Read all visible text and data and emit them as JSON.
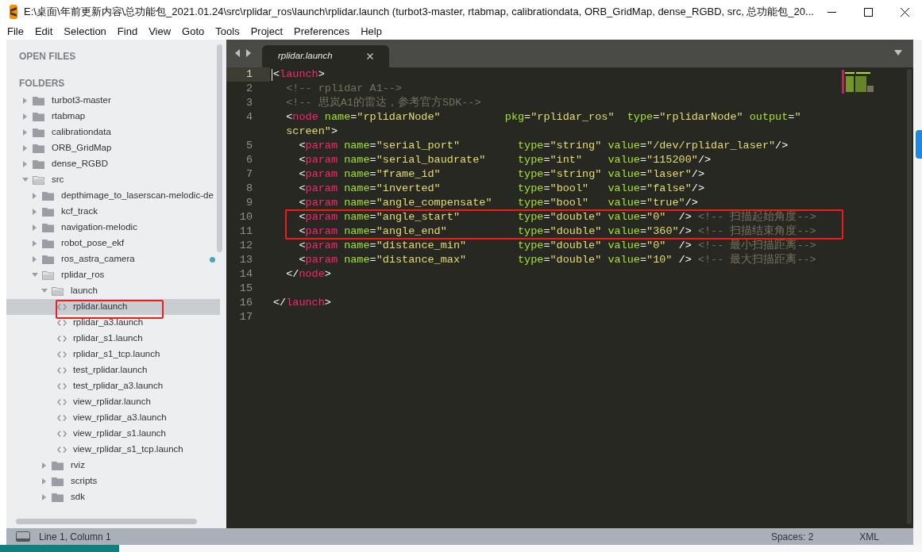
{
  "window": {
    "title": "E:\\桌面\\年前更新内容\\总功能包_2021.01.24\\src\\rplidar_ros\\launch\\rplidar.launch (turbot3-master, rtabmap, calibrationdata, ORB_GridMap, dense_RGBD, src, 总功能包_20..."
  },
  "menu": [
    "File",
    "Edit",
    "Selection",
    "Find",
    "View",
    "Goto",
    "Tools",
    "Project",
    "Preferences",
    "Help"
  ],
  "sidebar": {
    "open_files_heading": "OPEN FILES",
    "folders_heading": "FOLDERS",
    "tree": [
      {
        "kind": "folder",
        "label": "turbot3-master",
        "expanded": false,
        "selected": false
      },
      {
        "kind": "folder",
        "label": "rtabmap",
        "expanded": false,
        "selected": false
      },
      {
        "kind": "folder",
        "label": "calibrationdata",
        "expanded": false,
        "selected": false
      },
      {
        "kind": "folder",
        "label": "ORB_GridMap",
        "expanded": false,
        "selected": false
      },
      {
        "kind": "folder",
        "label": "dense_RGBD",
        "expanded": false,
        "selected": false
      },
      {
        "kind": "folder",
        "label": "src",
        "expanded": true,
        "selected": false,
        "children": [
          {
            "kind": "folder",
            "label": "depthimage_to_laserscan-melodic-de",
            "expanded": false,
            "selected": false
          },
          {
            "kind": "folder",
            "label": "kcf_track",
            "expanded": false,
            "selected": false
          },
          {
            "kind": "folder",
            "label": "navigation-melodic",
            "expanded": false,
            "selected": false
          },
          {
            "kind": "folder",
            "label": "robot_pose_ekf",
            "expanded": false,
            "selected": false
          },
          {
            "kind": "folder",
            "label": "ros_astra_camera",
            "expanded": false,
            "selected": false,
            "modified": true
          },
          {
            "kind": "folder",
            "label": "rplidar_ros",
            "expanded": true,
            "selected": false,
            "children": [
              {
                "kind": "folder",
                "label": "launch",
                "expanded": true,
                "selected": false,
                "children": [
                  {
                    "kind": "file",
                    "label": "rplidar.launch",
                    "selected": true,
                    "annotated": true
                  },
                  {
                    "kind": "file",
                    "label": "rplidar_a3.launch",
                    "selected": false
                  },
                  {
                    "kind": "file",
                    "label": "rplidar_s1.launch",
                    "selected": false
                  },
                  {
                    "kind": "file",
                    "label": "rplidar_s1_tcp.launch",
                    "selected": false
                  },
                  {
                    "kind": "file",
                    "label": "test_rplidar.launch",
                    "selected": false
                  },
                  {
                    "kind": "file",
                    "label": "test_rplidar_a3.launch",
                    "selected": false
                  },
                  {
                    "kind": "file",
                    "label": "view_rplidar.launch",
                    "selected": false
                  },
                  {
                    "kind": "file",
                    "label": "view_rplidar_a3.launch",
                    "selected": false
                  },
                  {
                    "kind": "file",
                    "label": "view_rplidar_s1.launch",
                    "selected": false
                  },
                  {
                    "kind": "file",
                    "label": "view_rplidar_s1_tcp.launch",
                    "selected": false
                  }
                ]
              },
              {
                "kind": "folder",
                "label": "rviz",
                "expanded": false,
                "selected": false
              },
              {
                "kind": "folder",
                "label": "scripts",
                "expanded": false,
                "selected": false
              },
              {
                "kind": "folder",
                "label": "sdk",
                "expanded": false,
                "selected": false
              }
            ]
          }
        ]
      }
    ]
  },
  "tabs": [
    {
      "label": "rplidar.launch",
      "selected": true
    }
  ],
  "editor": {
    "lines": [
      {
        "number": "1",
        "current": true,
        "segments": [
          "<launch>"
        ]
      },
      {
        "number": "2",
        "segments": [
          "  <!-- rplidar A1-->"
        ]
      },
      {
        "number": "3",
        "segments": [
          "  <!-- 思岚A1的雷达，参考官方SDK-->"
        ]
      },
      {
        "number": "4",
        "segments": [
          "  <node name=\"rplidarNode\"          ",
          "pkg=\"rplidar_ros\"  type=\"rplidarNode\" output=\""
        ],
        "wrap_text": "screen\">"
      },
      {
        "number": "5",
        "segments": [
          "    <param name=\"serial_port\"         ",
          "type=\"string\" value=\"/dev/rplidar_laser\"/>"
        ]
      },
      {
        "number": "6",
        "segments": [
          "    <param name=\"serial_baudrate\"     ",
          "type=\"int\"    value=\"115200\"/>"
        ]
      },
      {
        "number": "7",
        "segments": [
          "    <param name=\"frame_id\"            ",
          "type=\"string\" value=\"laser\"/>"
        ]
      },
      {
        "number": "8",
        "segments": [
          "    <param name=\"inverted\"            ",
          "type=\"bool\"   value=\"false\"/>"
        ]
      },
      {
        "number": "9",
        "segments": [
          "    <param name=\"angle_compensate\"    ",
          "type=\"bool\"   value=\"true\"/>"
        ]
      },
      {
        "number": "10",
        "annotated": true,
        "segments": [
          "    <param name=\"angle_start\"         ",
          "type=\"double\" value=\"0\"  /> ",
          "<!-- 扫描起始角度-->"
        ]
      },
      {
        "number": "11",
        "annotated": true,
        "segments": [
          "    <param name=\"angle_end\"           ",
          "type=\"double\" value=\"360\"/> ",
          "<!-- 扫描结束角度-->"
        ]
      },
      {
        "number": "12",
        "segments": [
          "    <param name=\"distance_min\"        ",
          "type=\"double\" value=\"0\"  /> ",
          "<!-- 最小扫描距离-->"
        ]
      },
      {
        "number": "13",
        "segments": [
          "    <param name=\"distance_max\"        ",
          "type=\"double\" value=\"10\" /> ",
          "<!-- 最大扫描距离-->"
        ]
      },
      {
        "number": "14",
        "segments": [
          "  </node>"
        ]
      },
      {
        "number": "15"
      },
      {
        "number": "16",
        "segments": [
          "</launch>"
        ]
      },
      {
        "number": "17"
      }
    ]
  },
  "status_bar": {
    "position": "Line 1, Column 1",
    "indentation": "Spaces: 2",
    "syntax": "XML"
  }
}
